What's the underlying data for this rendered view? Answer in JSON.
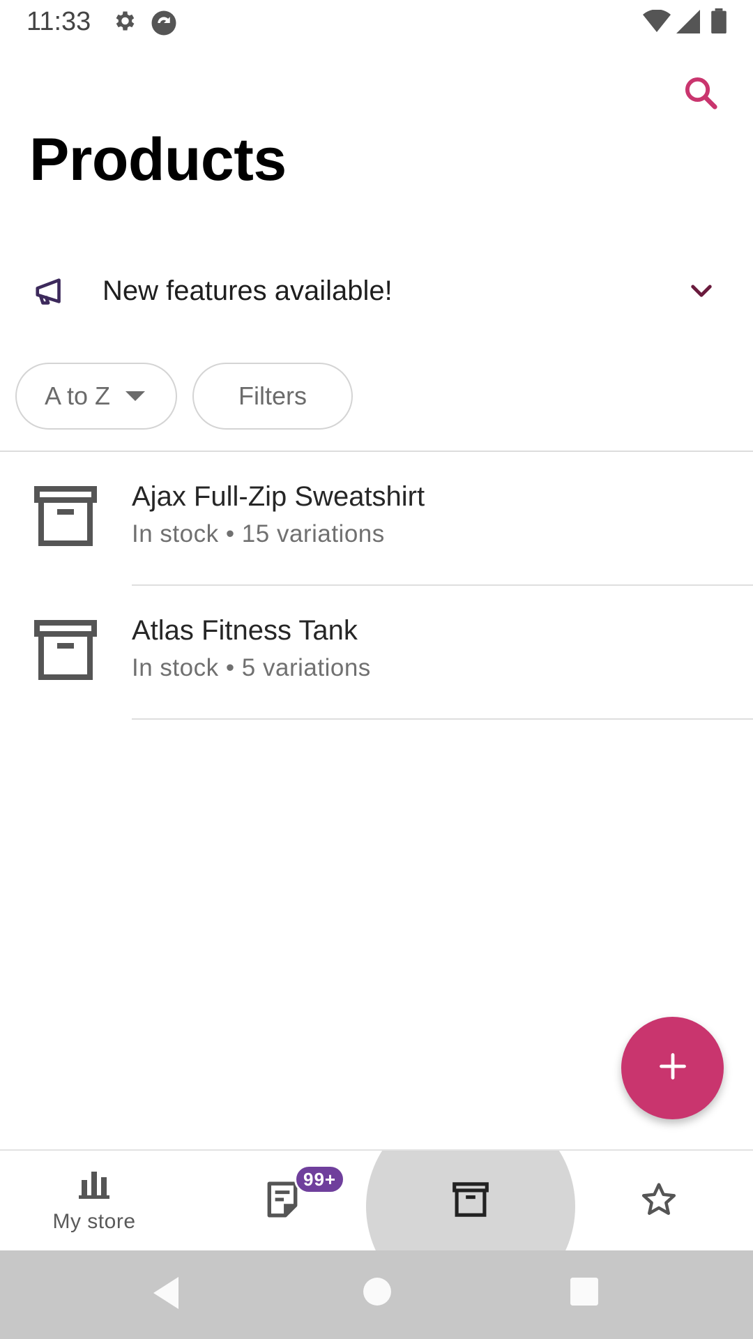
{
  "status_bar": {
    "time": "11:33",
    "icons": [
      "gear-icon",
      "sync-icon",
      "wifi-icon",
      "signal-icon",
      "battery-icon"
    ]
  },
  "header": {
    "title": "Products",
    "search_icon": "search-icon"
  },
  "banner": {
    "text": "New features available!",
    "icon": "megaphone-icon",
    "expand_icon": "chevron-down-icon"
  },
  "toolbar": {
    "sort_label": "A to Z",
    "filters_label": "Filters"
  },
  "products": [
    {
      "name": "Ajax Full-Zip Sweatshirt",
      "meta": "In stock • 15 variations"
    },
    {
      "name": "Atlas Fitness Tank",
      "meta": "In stock • 5 variations"
    }
  ],
  "fab": {
    "icon": "plus-icon"
  },
  "bottom_nav": {
    "items": [
      {
        "label": "My store",
        "icon": "bar-chart-icon"
      },
      {
        "label": "",
        "icon": "orders-icon",
        "badge": "99+"
      },
      {
        "label": "",
        "icon": "products-box-icon",
        "selected": true
      },
      {
        "label": "",
        "icon": "star-icon"
      }
    ]
  },
  "colors": {
    "accent": "#c9356e",
    "banner_chevron": "#6a1b3d",
    "megaphone": "#3d2a5c",
    "badge": "#6f3f9c"
  }
}
